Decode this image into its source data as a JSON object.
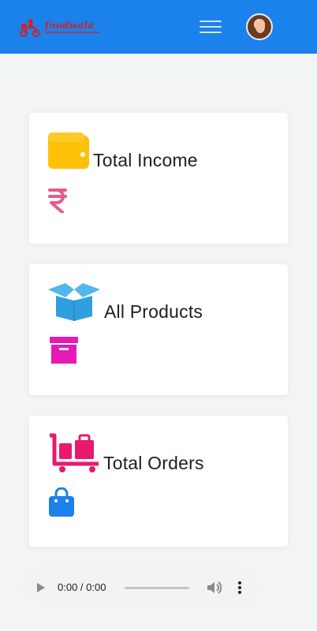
{
  "header": {
    "brand_name": "foodwala",
    "brand_color": "#d0202a",
    "bar_color": "#1a82ea",
    "menu_icon": "hamburger-menu-icon",
    "avatar_icon": "user-avatar"
  },
  "cards": [
    {
      "title": "Total Income",
      "icon": "wallet-icon",
      "icon_color": "#ffc107",
      "value_icon": "rupee-icon",
      "value_icon_color": "#e75a8a"
    },
    {
      "title": "All Products",
      "icon": "open-box-icon",
      "icon_color": "#2f9fe0",
      "value_icon": "archive-box-icon",
      "value_icon_color": "#e81ab4"
    },
    {
      "title": "Total Orders",
      "icon": "luggage-cart-icon",
      "icon_color": "#e8196e",
      "value_icon": "shopping-bag-icon",
      "value_icon_color": "#1a82ea"
    }
  ],
  "audio_player": {
    "time": "0:00 / 0:00",
    "play_icon": "play-icon",
    "volume_icon": "volume-icon",
    "more_icon": "more-vertical-icon"
  }
}
